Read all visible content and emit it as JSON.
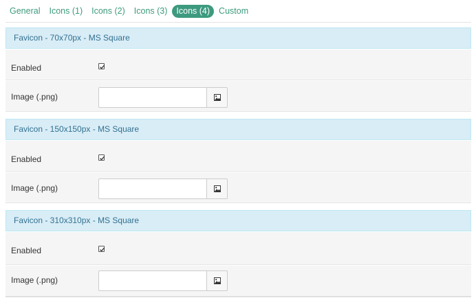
{
  "tabs": [
    {
      "label": "General",
      "active": false
    },
    {
      "label": "Icons (1)",
      "active": false
    },
    {
      "label": "Icons (2)",
      "active": false
    },
    {
      "label": "Icons (3)",
      "active": false
    },
    {
      "label": "Icons (4)",
      "active": true
    },
    {
      "label": "Custom",
      "active": false
    }
  ],
  "sections": [
    {
      "title": "Favicon - 70x70px - MS Square",
      "enabled_label": "Enabled",
      "enabled_checked": true,
      "image_label": "Image (.png)",
      "image_value": "",
      "image_button_icon": "image-icon"
    },
    {
      "title": "Favicon - 150x150px - MS Square",
      "enabled_label": "Enabled",
      "enabled_checked": true,
      "image_label": "Image (.png)",
      "image_value": "",
      "image_button_icon": "image-icon"
    },
    {
      "title": "Favicon - 310x310px - MS Square",
      "enabled_label": "Enabled",
      "enabled_checked": true,
      "image_label": "Image (.png)",
      "image_value": "",
      "image_button_icon": "image-icon"
    }
  ],
  "colors": {
    "accent": "#3d9a7e",
    "header_bg": "#d9edf7",
    "header_text": "#31708f",
    "row_bg": "#f5f5f5"
  }
}
